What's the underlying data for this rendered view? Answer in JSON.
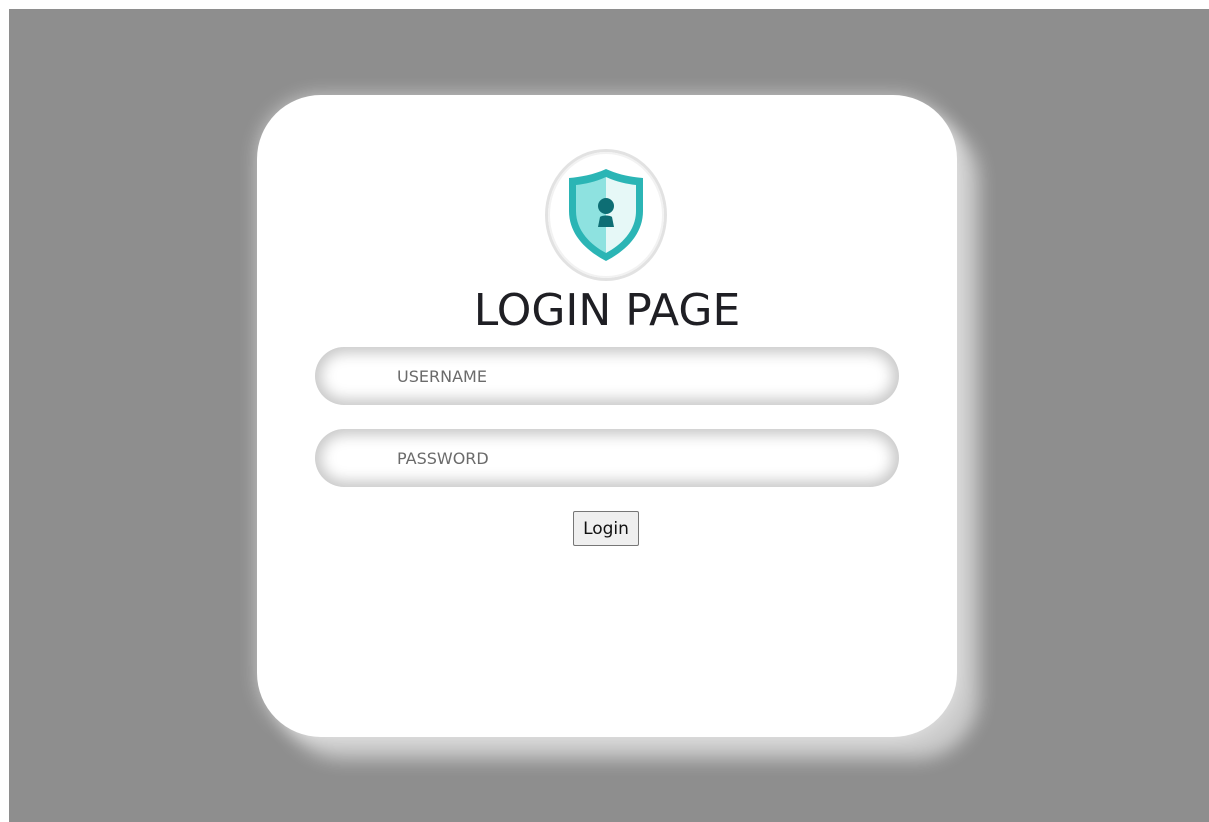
{
  "login": {
    "title": "LOGIN PAGE",
    "username_placeholder": "USERNAME",
    "password_placeholder": "PASSWORD",
    "button_label": "Login",
    "logo_icon": "shield-user-icon"
  },
  "colors": {
    "background": "#8e8e8e",
    "card": "#ffffff",
    "shield_teal": "#2bb5b5",
    "shield_light": "#8ee2e0",
    "person": "#0e6e74"
  }
}
